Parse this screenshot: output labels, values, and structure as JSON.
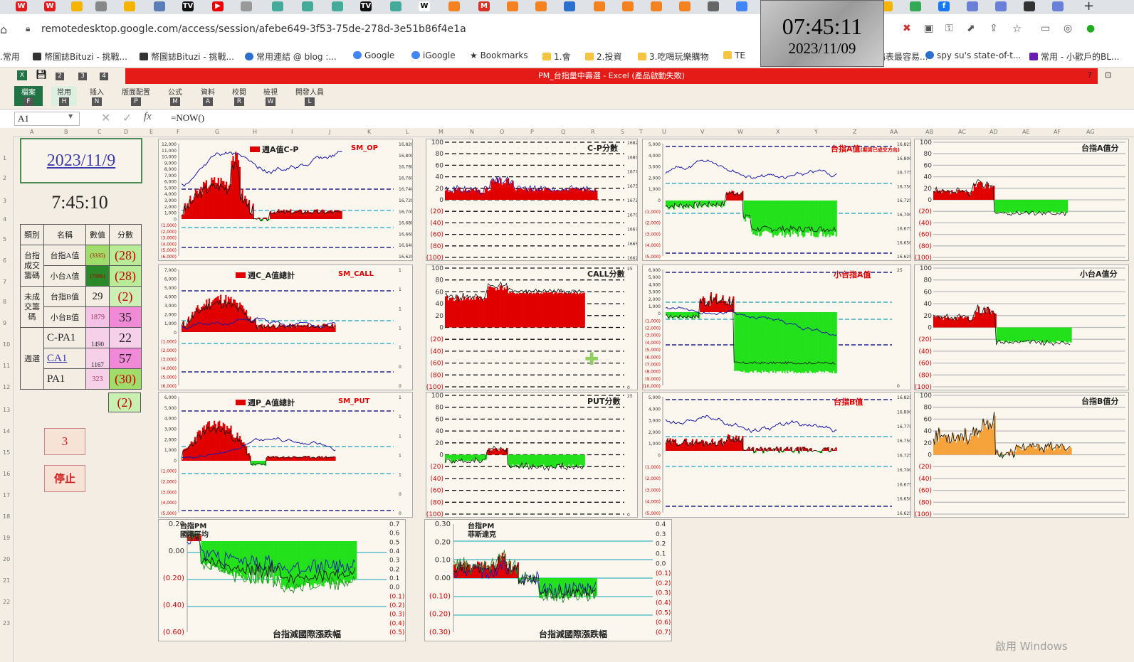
{
  "browser": {
    "url": "remotedesktop.google.com/access/session/afebe649-3f53-75de-278d-3e51b86f4e1a",
    "bookmarks": [
      {
        "label": ".常用",
        "color": "#f5c542"
      },
      {
        "label": "幣圖誌Bituzi - 挑戰...",
        "color": "#333"
      },
      {
        "label": "幣圖誌Bituzi - 挑戰...",
        "color": "#333"
      },
      {
        "label": "常用連結 @ blog :...",
        "color": "#2d6fcf"
      },
      {
        "label": "Google",
        "color": "#4285f4"
      },
      {
        "label": "iGoogle",
        "color": "#4285f4"
      },
      {
        "label": "Bookmarks",
        "color": "#555"
      },
      {
        "label": "1.會",
        "color": "#f5c542"
      },
      {
        "label": "2.投資",
        "color": "#f5c542"
      },
      {
        "label": "3.吃喝玩樂購物",
        "color": "#f5c542"
      },
      {
        "label": "TE",
        "color": "#f5c542"
      },
      {
        "label": "購表最容易...",
        "color": "#2d6fcf"
      },
      {
        "label": "spy su's state-of-t...",
        "color": "#2d6fcf"
      },
      {
        "label": "常用 - 小歡戶的BL...",
        "color": "#6a1bb0"
      }
    ]
  },
  "clock": {
    "time": "07:45:11",
    "date": "2023/11/09"
  },
  "excel": {
    "title": "PM_台指量中壽選 - Excel (產品啟動失敗)",
    "tabs": [
      {
        "label": "檔案",
        "key": "F"
      },
      {
        "label": "常用",
        "key": "H"
      },
      {
        "label": "插入",
        "key": "N"
      },
      {
        "label": "版面配置",
        "key": "P"
      },
      {
        "label": "公式",
        "key": "M"
      },
      {
        "label": "資料",
        "key": "A"
      },
      {
        "label": "校閱",
        "key": "R"
      },
      {
        "label": "檢視",
        "key": "W"
      },
      {
        "label": "開發人員",
        "key": "L"
      }
    ],
    "qat_keys": [
      "1",
      "2",
      "3",
      "4"
    ],
    "namebox": "A1",
    "formula": "=NOW()",
    "columns": [
      "A",
      "B",
      "C",
      "D",
      "E",
      "F",
      "G",
      "H",
      "I",
      "J",
      "K",
      "L",
      "M",
      "N",
      "O",
      "P",
      "Q",
      "R",
      "S",
      "T",
      "U",
      "V",
      "W",
      "X",
      "Y",
      "Z",
      "AA",
      "AB",
      "AC",
      "AD",
      "AE",
      "AF",
      "AG"
    ],
    "rows": [
      "1",
      "2",
      "3",
      "4",
      "5",
      "6",
      "7",
      "8",
      "9",
      "10",
      "11",
      "12",
      "13",
      "14",
      "15",
      "16",
      "17",
      "18",
      "19",
      "20",
      "21",
      "22",
      "23"
    ]
  },
  "left": {
    "date": "2023/11/9",
    "time": "7:45:10",
    "headers": [
      "類別",
      "名稱",
      "數值",
      "分數"
    ],
    "group1": "台指成交籌碼",
    "group2": "未成交籌碼",
    "group3": "週選",
    "rows": [
      {
        "name": "台指A值",
        "value": "(3335)",
        "score": "(28)"
      },
      {
        "name": "小台A值",
        "value": "(7986)",
        "score": "(28)"
      },
      {
        "name": "台指B值",
        "value": "29",
        "score": "(2)"
      },
      {
        "name": "小台B值",
        "value": "1879",
        "score": "35"
      },
      {
        "name": "C-PA1",
        "value": "1490",
        "score": "22"
      },
      {
        "name": "CA1",
        "value": "1167",
        "score": "57"
      },
      {
        "name": "PA1",
        "value": "323",
        "score": "(30)"
      }
    ],
    "extra_score": "(2)",
    "button_3": "3",
    "button_stop": "停止"
  },
  "charts": {
    "c1": {
      "title": "週A值C-P",
      "tag": "SM_OP",
      "y_left": [
        "12,000",
        "11,000",
        "10,000",
        "9,000",
        "8,000",
        "7,000",
        "6,000",
        "5,000",
        "4,000",
        "3,000",
        "2,000",
        "1,000",
        "0",
        "(1,000)",
        "(2,000)",
        "(3,000)",
        "(4,000)",
        "(5,000)",
        "(6,000)"
      ],
      "y_right": [
        "16,820",
        "16,800",
        "16,780",
        "16,760",
        "16,740",
        "16,720",
        "16,700",
        "16,680",
        "16,660",
        "16,640",
        "16,620"
      ]
    },
    "c2": {
      "title": "C-P分數",
      "y_left": [
        "100",
        "80",
        "60",
        "40",
        "20",
        "0",
        "(20)",
        "(40)",
        "(60)",
        "(80)",
        "(100)"
      ],
      "y_right": [
        "16825",
        "16800",
        "16775",
        "16750",
        "16725",
        "16700",
        "16675",
        "16650",
        "16625"
      ]
    },
    "c3": {
      "title": "台指A值",
      "subtitle": "(期貨已成交方向)",
      "y_left": [
        "5,000",
        "4,000",
        "3,000",
        "2,000",
        "1,000",
        "0",
        "(1,000)",
        "(2,000)",
        "(3,000)",
        "(4,000)",
        "(5,000)"
      ],
      "y_right": [
        "16,825",
        "16,800",
        "16,775",
        "16,750",
        "16,725",
        "16,700",
        "16,675",
        "16,650",
        "16,625"
      ]
    },
    "c4": {
      "title": "台指A值分",
      "y_left": [
        "100",
        "80",
        "60",
        "40",
        "20",
        "0",
        "(20)",
        "(40)",
        "(60)",
        "(80)",
        "(100)"
      ]
    },
    "c5": {
      "title": "週C_A值總計",
      "tag": "SM_CALL",
      "y_left": [
        "7,000",
        "6,000",
        "5,000",
        "4,000",
        "3,000",
        "2,000",
        "1,000",
        "0",
        "(1,000)",
        "(2,000)",
        "(3,000)",
        "(4,000)",
        "(5,000)",
        "(6,000)"
      ],
      "y_right": [
        "1",
        "1",
        "1",
        "1",
        "1",
        "0",
        "0"
      ]
    },
    "c6": {
      "title": "CALL分數",
      "y_left": [
        "100",
        "80",
        "60",
        "40",
        "20",
        "0",
        "(20)",
        "(40)",
        "(60)",
        "(80)",
        "(100)"
      ],
      "y_right": [
        "25",
        "0"
      ]
    },
    "c7": {
      "title": "小台指A值",
      "y_left": [
        "6,000",
        "5,000",
        "4,000",
        "3,000",
        "2,000",
        "1,000",
        "0",
        "(1,000)",
        "(2,000)",
        "(3,000)",
        "(4,000)",
        "(5,000)",
        "(6,000)",
        "(7,000)",
        "(8,000)",
        "(9,000)",
        "(10,000)"
      ],
      "y_right": [
        "25",
        "0"
      ]
    },
    "c8": {
      "title": "小台A值分",
      "y_left": [
        "100",
        "80",
        "60",
        "40",
        "20",
        "0",
        "(20)",
        "(40)",
        "(60)",
        "(80)",
        "(100)"
      ]
    },
    "c9": {
      "title": "週P_A值總計",
      "tag": "SM_PUT",
      "y_left": [
        "6,000",
        "5,000",
        "4,000",
        "3,000",
        "2,000",
        "1,000",
        "0",
        "(1,000)",
        "(2,000)",
        "(3,000)",
        "(4,000)",
        "(5,000)"
      ],
      "y_right": [
        "1",
        "1",
        "1",
        "1",
        "1",
        "0",
        "0"
      ]
    },
    "c10": {
      "title": "PUT分數",
      "y_left": [
        "100",
        "80",
        "60",
        "40",
        "20",
        "0",
        "(20)",
        "(40)",
        "(60)",
        "(80)",
        "(100)"
      ],
      "y_right": [
        "25",
        "0"
      ]
    },
    "c11": {
      "title": "台指B值",
      "y_left": [
        "5,000",
        "4,000",
        "3,000",
        "2,000",
        "1,000",
        "0",
        "(1,000)",
        "(2,000)",
        "(3,000)",
        "(4,000)",
        "(5,000)"
      ],
      "y_right": [
        "16,825",
        "16,800",
        "16,775",
        "16,750",
        "16,725",
        "16,700",
        "16,675",
        "16,650",
        "16,625"
      ]
    },
    "c12": {
      "title": "台指B值分",
      "y_left": [
        "100",
        "80",
        "60",
        "40",
        "20",
        "0",
        "(20)",
        "(40)",
        "(60)",
        "(80)",
        "(100)"
      ]
    },
    "c13": {
      "legend1": "台指PM",
      "legend2": "國際平均",
      "bottom": "台指減國際漲跌幅",
      "y_left": [
        "0.20",
        "0.00",
        "(0.20)",
        "(0.40)",
        "(0.60)"
      ],
      "y_right": [
        "0.7",
        "0.6",
        "0.5",
        "0.4",
        "0.3",
        "0.2",
        "0.1",
        "0.0",
        "(0.1)",
        "(0.2)",
        "(0.3)",
        "(0.4)",
        "(0.5)"
      ]
    },
    "c14": {
      "legend1": "台指PM",
      "legend2": "菲斯達克",
      "bottom": "台指減國際漲跌幅",
      "y_left": [
        "0.30",
        "0.20",
        "0.10",
        "0.00",
        "(0.10)",
        "(0.20)",
        "(0.30)"
      ],
      "y_right": [
        "0.4",
        "0.3",
        "0.2",
        "0.1",
        "0.0",
        "(0.1)",
        "(0.2)",
        "(0.3)",
        "(0.4)",
        "(0.5)",
        "(0.6)",
        "(0.7)"
      ]
    }
  },
  "watermark": "啟用 Windows"
}
